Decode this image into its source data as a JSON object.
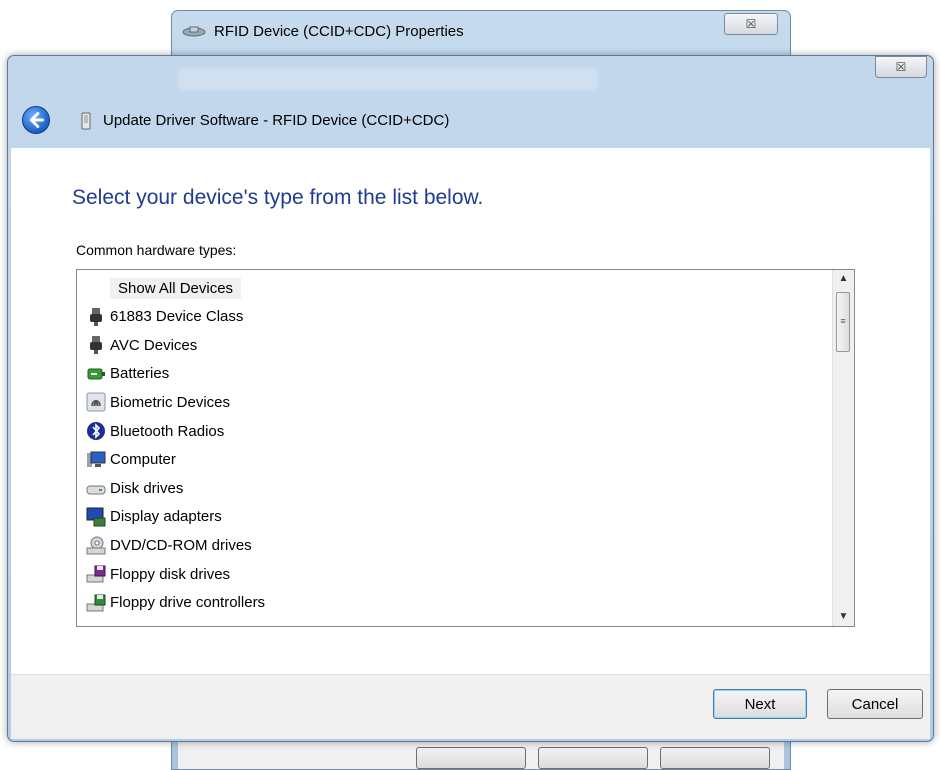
{
  "background_window": {
    "title": "RFID Device (CCID+CDC) Properties",
    "close_label": "☒"
  },
  "main_window": {
    "close_label": "☒",
    "wizard_title": "Update Driver Software - RFID Device (CCID+CDC)"
  },
  "content": {
    "heading": "Select your device's type from the list below.",
    "list_label": "Common hardware types:",
    "items": [
      {
        "label": "Show All Devices",
        "icon": "none",
        "selected": true
      },
      {
        "label": "61883 Device Class",
        "icon": "connector-icon"
      },
      {
        "label": "AVC Devices",
        "icon": "connector-icon"
      },
      {
        "label": "Batteries",
        "icon": "battery-icon"
      },
      {
        "label": "Biometric Devices",
        "icon": "fingerprint-icon"
      },
      {
        "label": "Bluetooth Radios",
        "icon": "bluetooth-icon"
      },
      {
        "label": "Computer",
        "icon": "computer-icon"
      },
      {
        "label": "Disk drives",
        "icon": "disk-drive-icon"
      },
      {
        "label": "Display adapters",
        "icon": "display-adapter-icon"
      },
      {
        "label": "DVD/CD-ROM drives",
        "icon": "dvd-drive-icon"
      },
      {
        "label": "Floppy disk drives",
        "icon": "floppy-drive-icon"
      },
      {
        "label": "Floppy drive controllers",
        "icon": "floppy-controller-icon"
      }
    ]
  },
  "footer": {
    "next_label": "Next",
    "cancel_label": "Cancel"
  },
  "colors": {
    "heading": "#1e3d8f",
    "window_frame": "#b3cce6",
    "footer": "#f0f0f0"
  }
}
